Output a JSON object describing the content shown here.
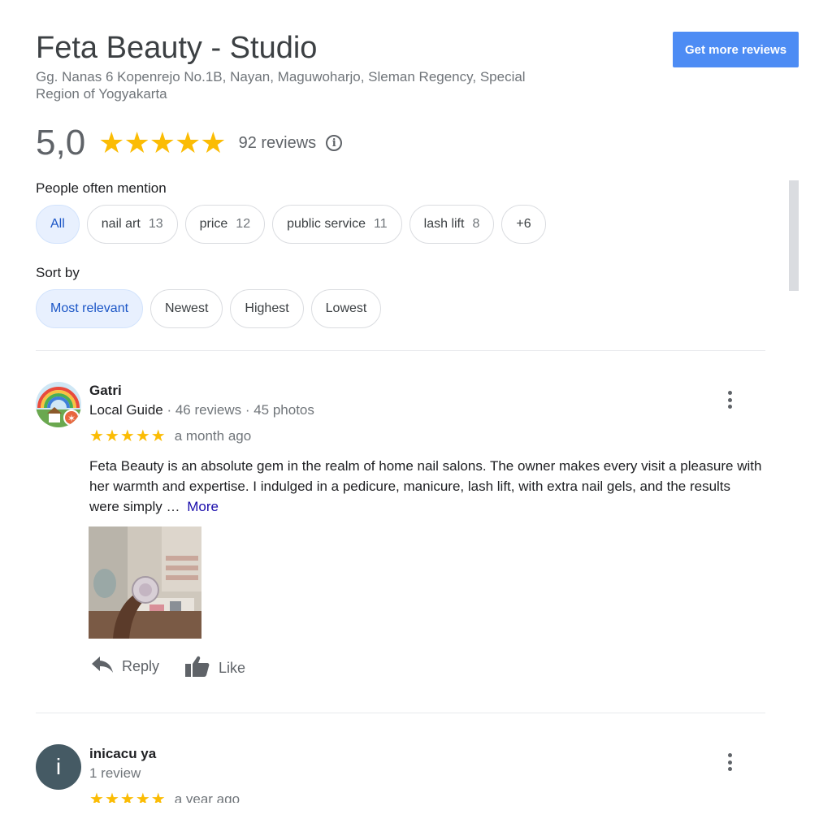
{
  "business": {
    "name": "Feta Beauty - Studio",
    "address": "Gg. Nanas 6 Kopenrejo No.1B, Nayan, Maguwoharjo, Sleman Regency, Special Region of Yogyakarta",
    "get_reviews_label": "Get more reviews"
  },
  "rating": {
    "score": "5,0",
    "stars": 5,
    "reviews_text": "92 reviews",
    "info_icon": "info-icon"
  },
  "mentions": {
    "label": "People often mention",
    "chips": [
      {
        "label": "All",
        "count": ""
      },
      {
        "label": "nail art",
        "count": "13"
      },
      {
        "label": "price",
        "count": "12"
      },
      {
        "label": "public service",
        "count": "11"
      },
      {
        "label": "lash lift",
        "count": "8"
      },
      {
        "label": "+6",
        "count": ""
      }
    ]
  },
  "sort": {
    "label": "Sort by",
    "options": [
      "Most relevant",
      "Newest",
      "Highest",
      "Lowest"
    ]
  },
  "reviews": [
    {
      "name": "Gatri",
      "guide": "Local Guide",
      "stats": " · 46 reviews · 45 photos",
      "stars": 5,
      "time": "a month ago",
      "text": "Feta Beauty is an absolute gem in the realm of home nail salons. The owner makes every visit a pleasure with her warmth and expertise. I indulged in a pedicure, manicure, lash lift, with extra nail gels, and the results were simply …",
      "more_label": "More",
      "reply_label": "Reply",
      "like_label": "Like"
    },
    {
      "name": "inicacu ya",
      "avatar_letter": "i",
      "stats": "1 review",
      "stars": 5,
      "time": "a year ago"
    }
  ],
  "colors": {
    "accent": "#4d8cf4",
    "star": "#fbbc04",
    "active_chip_bg": "#e8f0fe",
    "active_chip_text": "#1a55c6",
    "link": "#1a0dab"
  }
}
